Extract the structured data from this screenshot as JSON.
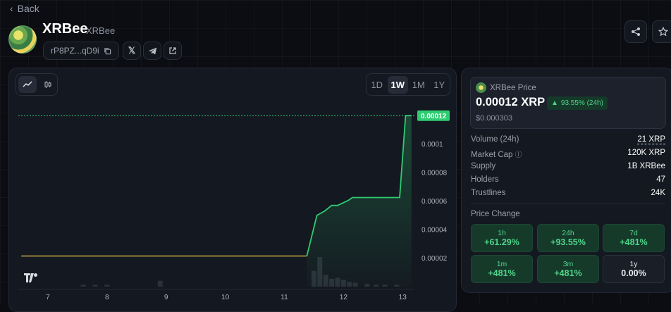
{
  "nav": {
    "back_label": "Back"
  },
  "token": {
    "name": "XRBee",
    "ticker": "XRBee",
    "address_short": "rP8PZ...qD9i"
  },
  "chart": {
    "ranges": [
      "1D",
      "1W",
      "1M",
      "1Y"
    ],
    "selected_range": "1W",
    "price_badge": "0.00012",
    "line_color": "#2ecc71",
    "flat_color": "#c9a94a"
  },
  "chart_data": {
    "type": "line",
    "title": "",
    "xlabel": "",
    "ylabel": "",
    "x_ticks": [
      "7",
      "8",
      "9",
      "10",
      "11",
      "12",
      "13"
    ],
    "y_ticks": [
      "0.00002",
      "0.00004",
      "0.00006",
      "0.00008",
      "0.0001",
      "0.00012"
    ],
    "ylim": [
      0,
      0.000128
    ],
    "xlim": [
      6.5,
      13.2
    ],
    "series": [
      {
        "name": "",
        "x": [
          6.55,
          11.38,
          11.55,
          11.68,
          11.8,
          11.9,
          12.08,
          12.15,
          12.5,
          12.7,
          12.95,
          13.05,
          13.15
        ],
        "y": [
          2.15e-05,
          2.15e-05,
          5e-05,
          5.3e-05,
          5.7e-05,
          5.7e-05,
          6.05e-05,
          6.25e-05,
          6.25e-05,
          6.25e-05,
          6.25e-05,
          0.00012,
          0.00012
        ]
      }
    ],
    "volume": {
      "x": [
        7.6,
        7.8,
        8.0,
        8.9,
        11.5,
        11.6,
        11.7,
        11.8,
        11.9,
        12.0,
        12.1,
        12.2,
        12.4,
        12.55,
        12.7,
        12.9
      ],
      "v": [
        2,
        2,
        2,
        6,
        16,
        30,
        12,
        8,
        9,
        7,
        5,
        4,
        3,
        2,
        2,
        2
      ]
    }
  },
  "stats": {
    "price_label": "XRBee Price",
    "price": "0.00012 XRP",
    "change_24h": "93.55% (24h)",
    "price_usd": "$0.000303",
    "rows": [
      {
        "k": "Volume (24h)",
        "v": "21 XRP"
      },
      {
        "k": "Market Cap",
        "v": "120K XRP"
      },
      {
        "k": "Supply",
        "v": "1B XRBee"
      },
      {
        "k": "Holders",
        "v": "47"
      },
      {
        "k": "Trustlines",
        "v": "24K"
      }
    ],
    "change_title": "Price Change",
    "tiles": [
      {
        "l": "1h",
        "p": "+61.29%"
      },
      {
        "l": "24h",
        "p": "+93.55%"
      },
      {
        "l": "7d",
        "p": "+481%"
      },
      {
        "l": "1m",
        "p": "+481%"
      },
      {
        "l": "3m",
        "p": "+481%"
      },
      {
        "l": "1y",
        "p": "0.00%"
      }
    ]
  }
}
